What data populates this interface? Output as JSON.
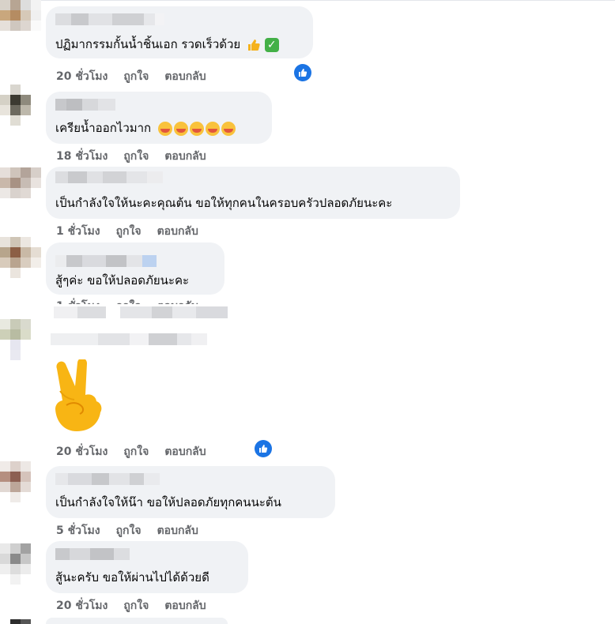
{
  "actions": {
    "like": "ถูกใจ",
    "reply": "ตอบกลับ"
  },
  "comments": [
    {
      "text": "ปฏิมากรรมกั้นน้ำชิ้นเอก รวดเร็วด้วย",
      "emojis": [
        "thumbs-up-icon",
        "check-mark-icon"
      ],
      "time": "20 ชั่วโมง",
      "has_like_badge": true
    },
    {
      "text": "เครียน้ำออกไวมาก",
      "emojis": [
        "smiling-face-hearts-icon x5"
      ],
      "time": "18 ชั่วโมง",
      "has_like_badge": false
    },
    {
      "name_fragment": "ไพ่ปูดแพแพ...",
      "text": "เป็นกำลังใจให้นะคะคุณต้น ขอให้ทุกคนในครอบครัวปลอดภัยนะคะ",
      "time": "1 ชั่วโมง",
      "has_like_badge": false
    },
    {
      "text": "สู้ๆค่ะ ขอให้ปลอดภัยนะคะ",
      "time": "1 ชั่วโมง",
      "has_like_badge": false
    },
    {
      "sticker": "victory-hand-sticker",
      "time": "20 ชั่วโมง",
      "has_like_badge": true
    },
    {
      "text": "เป็นกำลังใจให้น๊า ขอให้ปลอดภัยทุกคนนะต้น",
      "time": "5 ชั่วโมง",
      "has_like_badge": false
    },
    {
      "text": "สู้นะครับ ขอให้ผ่านไปได้ด้วยดี",
      "time": "20 ชั่วโมง",
      "has_like_badge": false
    }
  ],
  "colors": {
    "bubble": "#f0f2f5",
    "meta": "#65676b",
    "like_blue": "#1b74e4"
  }
}
